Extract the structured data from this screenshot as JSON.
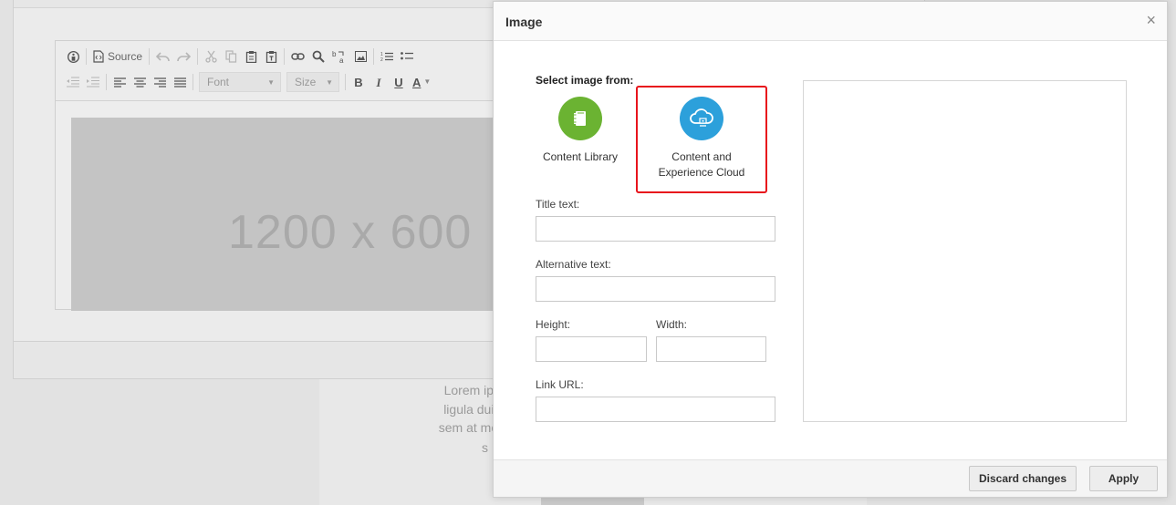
{
  "editor": {
    "toolbar": {
      "source_label": "Source",
      "font_placeholder": "Font",
      "size_placeholder": "Size",
      "bold": "B",
      "italic": "I",
      "underline": "U",
      "text_color": "A"
    },
    "placeholder_image_text": "1200 x 600"
  },
  "background": {
    "lorem_lines": [
      "Lorem ipsum dolor s",
      "ligula duis orci ac, ar",
      "sem at morbi, at cursu",
      "s"
    ]
  },
  "dialog": {
    "title": "Image",
    "close_glyph": "×",
    "select_label": "Select image from:",
    "sources": [
      {
        "label_line1": "Content Library",
        "label_line2": "",
        "icon": "content-library-icon",
        "color": "#6bb332"
      },
      {
        "label_line1": "Content and",
        "label_line2": "Experience Cloud",
        "icon": "cloud-icon",
        "color": "#2ca0db",
        "highlighted": true
      }
    ],
    "fields": {
      "title_text": {
        "label": "Title text:",
        "value": ""
      },
      "alt_text": {
        "label": "Alternative text:",
        "value": ""
      },
      "height": {
        "label": "Height:",
        "value": ""
      },
      "width": {
        "label": "Width:",
        "value": ""
      },
      "link_url": {
        "label": "Link URL:",
        "value": ""
      }
    },
    "buttons": {
      "discard": "Discard changes",
      "apply": "Apply"
    },
    "highlight_color": "#e8141c"
  }
}
